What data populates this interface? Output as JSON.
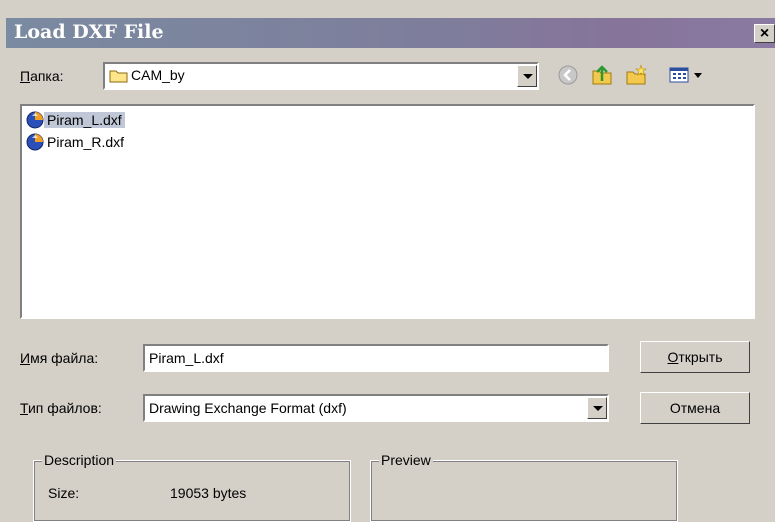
{
  "window": {
    "title": "Load DXF File",
    "close_glyph": "×"
  },
  "folder": {
    "label": "Папка:",
    "value": "CAM_by"
  },
  "toolbar": {
    "icons": [
      "back-icon",
      "up-folder-icon",
      "new-folder-icon",
      "view-menu-icon"
    ]
  },
  "files": [
    {
      "name": "Piram_L.dxf",
      "selected": true,
      "icon": "dxf-file-icon"
    },
    {
      "name": "Piram_R.dxf",
      "selected": false,
      "icon": "dxf-file-icon"
    }
  ],
  "filename": {
    "label": "Имя файла:",
    "value": "Piram_L.dxf"
  },
  "filetype": {
    "label": "Тип файлов:",
    "value": "Drawing Exchange Format (dxf)"
  },
  "buttons": {
    "open": "Открыть",
    "cancel": "Отмена"
  },
  "description": {
    "title": "Description",
    "size_label": "Size:",
    "size_value": "19053 bytes"
  },
  "preview": {
    "title": "Preview"
  }
}
